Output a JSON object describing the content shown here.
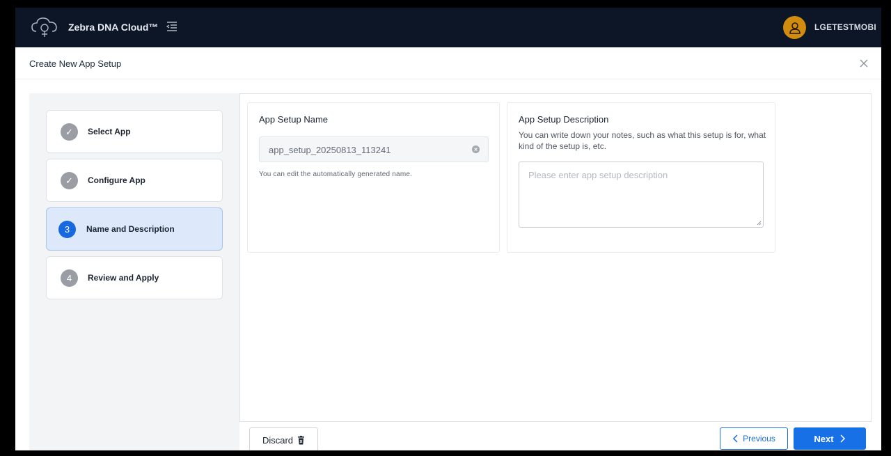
{
  "header": {
    "brand": "Zebra DNA Cloud™",
    "username": "LGETESTMOBI"
  },
  "modal": {
    "title": "Create New App Setup"
  },
  "steps": [
    {
      "label": "Select App",
      "badge": "✓",
      "status": "done"
    },
    {
      "label": "Configure App",
      "badge": "✓",
      "status": "done"
    },
    {
      "label": "Name and Description",
      "badge": "3",
      "status": "active"
    },
    {
      "label": "Review and Apply",
      "badge": "4",
      "status": "pending"
    }
  ],
  "name_card": {
    "title": "App Setup Name",
    "value": "app_setup_20250813_113241",
    "hint": "You can edit the automatically generated name."
  },
  "desc_card": {
    "title": "App Setup Description",
    "help": "You can write down your notes, such as what this setup is for, what kind of the setup is, etc.",
    "placeholder": "Please enter app setup description"
  },
  "footer": {
    "discard_label": "Discard",
    "previous_label": "Previous",
    "next_label": "Next"
  },
  "colors": {
    "topbar": "#0c1627",
    "accent": "#1870e6",
    "avatar": "#d18c10",
    "active_step": "#dde9fb"
  },
  "icons": {
    "logo": "cloud-logo-icon",
    "menu": "menu-collapse-icon",
    "avatar": "user-icon",
    "close": "close-icon",
    "clear": "clear-input-icon",
    "discard": "trash-icon",
    "previous": "chevron-left-icon",
    "next": "chevron-right-icon"
  }
}
